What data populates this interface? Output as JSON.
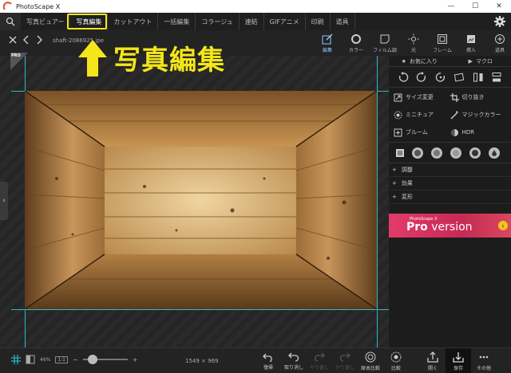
{
  "window": {
    "title": "PhotoScape X",
    "controls": [
      "—",
      "☐",
      "✕"
    ]
  },
  "menu": {
    "items": [
      "写真ビュアー",
      "写真編集",
      "カットアウト",
      "一括編集",
      "コラージュ",
      "連結",
      "GIFアニメ",
      "印刷",
      "道具"
    ],
    "active_index": 1
  },
  "toolbar": {
    "filename": "shaft-2086925.jpe",
    "tabs": [
      {
        "label": "編集",
        "icon": "edit-icon"
      },
      {
        "label": "カラー",
        "icon": "color-icon"
      },
      {
        "label": "フィルム調",
        "icon": "film-icon"
      },
      {
        "label": "光",
        "icon": "light-icon"
      },
      {
        "label": "フレーム",
        "icon": "frame-icon"
      },
      {
        "label": "挿入",
        "icon": "insert-icon"
      },
      {
        "label": "道具",
        "icon": "tools-icon"
      }
    ],
    "active_tab": 0
  },
  "annotation": {
    "text": "写真編集"
  },
  "canvas": {
    "pro_badge": "PRO"
  },
  "right_panel": {
    "favorites": "お気に入り",
    "macro": "マクロ",
    "tools": [
      {
        "label": "サイズ変更",
        "icon": "resize-icon"
      },
      {
        "label": "切り抜き",
        "icon": "crop-icon"
      },
      {
        "label": "ミニチュア",
        "icon": "miniature-icon"
      },
      {
        "label": "マジックカラー",
        "icon": "magic-color-icon"
      },
      {
        "label": "ブルーム",
        "icon": "bloom-icon"
      },
      {
        "label": "HDR",
        "icon": "hdr-icon"
      }
    ],
    "sections": [
      "調整",
      "効果",
      "変形"
    ],
    "banner": {
      "small": "PhotoScape X",
      "brand": "Pro",
      "rest": " version"
    }
  },
  "bottom": {
    "zoom": "46%",
    "ratio": "1:1",
    "zoom_level": 0.15,
    "dimensions": "1549 × 969",
    "actions": [
      {
        "label": "復帰",
        "icon": "revert-icon",
        "enabled": true
      },
      {
        "label": "取り消し",
        "icon": "undo-icon",
        "enabled": true
      },
      {
        "label": "やり直し",
        "icon": "redo-icon",
        "enabled": false
      },
      {
        "label": "やり直し",
        "icon": "redo-all-icon",
        "enabled": false
      },
      {
        "label": "原本比較",
        "icon": "compare-original-icon",
        "enabled": true
      },
      {
        "label": "比較",
        "icon": "compare-icon",
        "enabled": true
      },
      {
        "label": "開く",
        "icon": "open-icon",
        "enabled": true
      },
      {
        "label": "保存",
        "icon": "save-icon",
        "enabled": true
      },
      {
        "label": "その他",
        "icon": "more-icon",
        "enabled": true
      }
    ]
  },
  "colors": {
    "accent": "#2bb9c9",
    "highlight": "#f5e61a",
    "banner": "#d8355f"
  }
}
